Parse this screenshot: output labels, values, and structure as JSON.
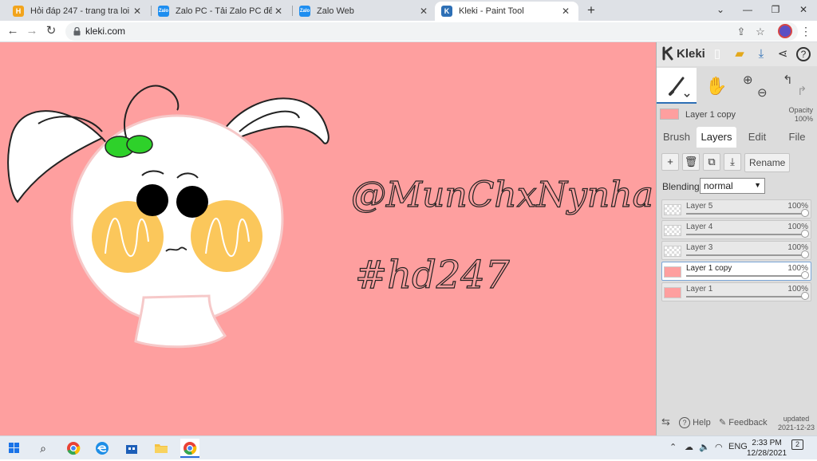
{
  "browser": {
    "tabs": [
      {
        "title": "Hỏi đáp 247 - trang tra loi",
        "icon": "hoidap-favicon",
        "active": false
      },
      {
        "title": "Zalo PC - Tải Zalo PC để làm việc",
        "icon": "zalo-favicon",
        "active": false
      },
      {
        "title": "Zalo Web",
        "icon": "zalo-favicon",
        "active": false
      },
      {
        "title": "Kleki - Paint Tool",
        "icon": "kleki-favicon",
        "active": true
      }
    ],
    "close_glyph": "✕",
    "new_tab_glyph": "+",
    "window_controls": {
      "tabsearch": "⌄",
      "minimize": "—",
      "restore": "❐",
      "close": "✕"
    },
    "url": "kleki.com",
    "nav": {
      "back": "←",
      "forward": "→",
      "reload": "↻"
    }
  },
  "canvas": {
    "background": "#fe9f9f",
    "handle_text": "@MunChxNynha",
    "hashtag_text": "#hd247"
  },
  "panel": {
    "app_name": "Kleki",
    "current_layer": {
      "name": "Layer 1 copy",
      "opacity_label": "Opacity",
      "opacity_value": "100%"
    },
    "tabs": [
      "Brush",
      "Layers",
      "Edit",
      "File"
    ],
    "active_tab": "Layers",
    "rename_label": "Rename",
    "blending_label": "Blending",
    "blending_value": "normal",
    "layers": [
      {
        "name": "Layer 5",
        "opacity": "100%",
        "thumb": "transparent"
      },
      {
        "name": "Layer 4",
        "opacity": "100%",
        "thumb": "transparent"
      },
      {
        "name": "Layer 3",
        "opacity": "100%",
        "thumb": "transparent"
      },
      {
        "name": "Layer 1 copy",
        "opacity": "100%",
        "thumb": "pink",
        "selected": true
      },
      {
        "name": "Layer 1",
        "opacity": "100%",
        "thumb": "pink"
      }
    ],
    "footer": {
      "help": "Help",
      "feedback": "Feedback",
      "updated_label": "updated",
      "updated_date": "2021-12-23"
    }
  },
  "taskbar": {
    "language": "ENG",
    "time": "2:33 PM",
    "date": "12/28/2021",
    "notification_count": "2"
  },
  "colors": {
    "canvas_pink": "#fe9f9f",
    "bow_green": "#2ed12a",
    "cheek_yellow": "#fbc75b",
    "accent_blue": "#2d6fb5"
  }
}
